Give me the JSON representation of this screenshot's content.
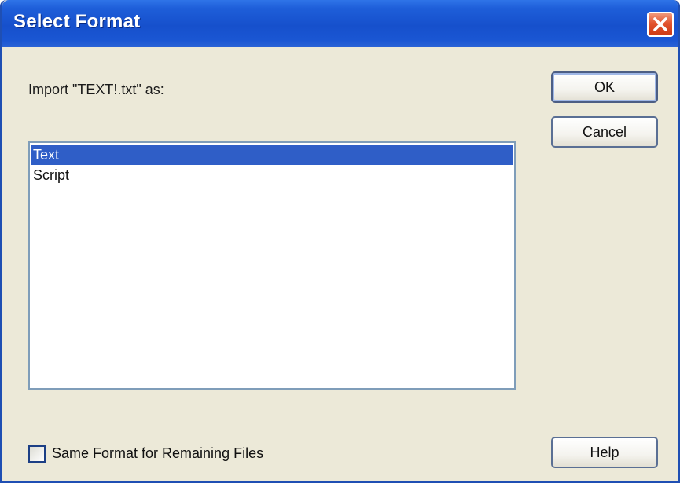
{
  "window": {
    "title": "Select Format"
  },
  "dialog": {
    "prompt": "Import \"TEXT!.txt\" as:",
    "formats": [
      {
        "label": "Text",
        "selected": true
      },
      {
        "label": "Script",
        "selected": false
      }
    ],
    "same_format_checkbox": {
      "label": "Same Format for Remaining Files",
      "checked": false
    }
  },
  "buttons": {
    "ok": "OK",
    "cancel": "Cancel",
    "help": "Help"
  },
  "icons": {
    "close": "close-icon"
  },
  "colors": {
    "titlebar": "#1650cc",
    "window_bg": "#ece9d8",
    "selection": "#2f5ec7",
    "close_button": "#e2532e"
  }
}
